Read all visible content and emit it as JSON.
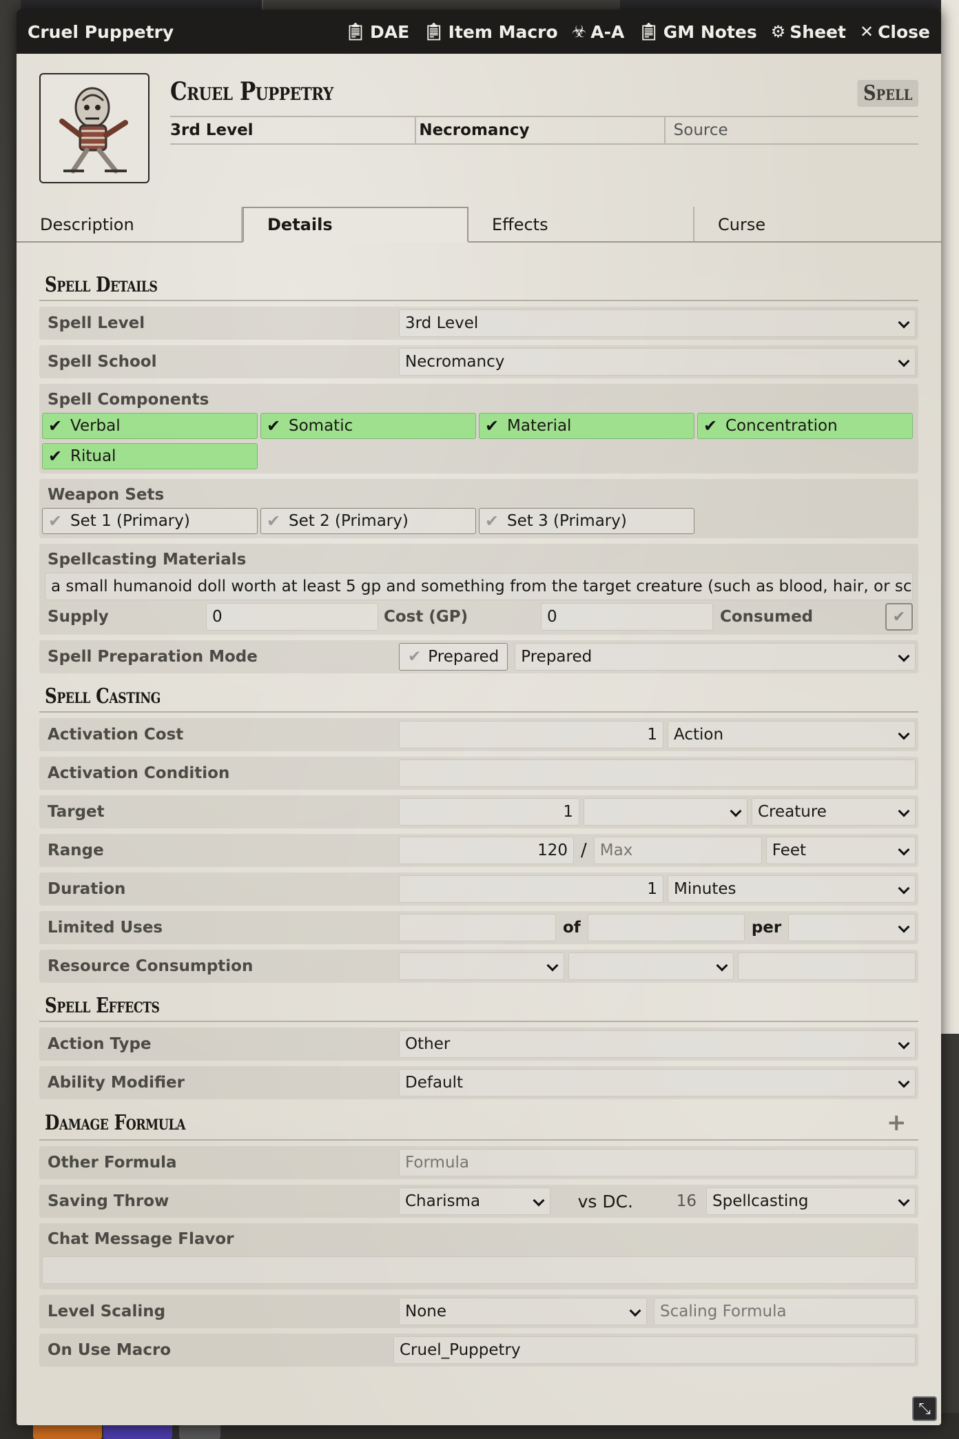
{
  "window": {
    "title": "Cruel Puppetry",
    "header_buttons": [
      {
        "label": "DAE",
        "icon": "clipboard-icon"
      },
      {
        "label": "Item Macro",
        "icon": "clipboard-icon"
      },
      {
        "label": "A-A",
        "icon": "biohazard-icon"
      },
      {
        "label": "GM Notes",
        "icon": "clipboard-icon"
      },
      {
        "label": "Sheet",
        "icon": "gear-icon"
      },
      {
        "label": "Close",
        "icon": "close-icon"
      }
    ]
  },
  "item": {
    "name": "Cruel Puppetry",
    "type": "Spell",
    "level": "3rd Level",
    "school": "Necromancy",
    "source_placeholder": "Source"
  },
  "tabs": [
    "Description",
    "Details",
    "Effects",
    "Curse"
  ],
  "active_tab": "Details",
  "spell_details": {
    "heading": "Spell Details",
    "level_label": "Spell Level",
    "level_value": "3rd Level",
    "school_label": "Spell School",
    "school_value": "Necromancy",
    "components_label": "Spell Components",
    "components": [
      {
        "label": "Verbal",
        "checked": true
      },
      {
        "label": "Somatic",
        "checked": true
      },
      {
        "label": "Material",
        "checked": true
      },
      {
        "label": "Concentration",
        "checked": true
      },
      {
        "label": "Ritual",
        "checked": true
      }
    ],
    "weapon_sets_label": "Weapon Sets",
    "weapon_sets": [
      {
        "label": "Set 1 (Primary)",
        "checked": false
      },
      {
        "label": "Set 2 (Primary)",
        "checked": false
      },
      {
        "label": "Set 3 (Primary)",
        "checked": false
      }
    ],
    "materials_label": "Spellcasting Materials",
    "materials_value": "a small humanoid doll worth at least 5 gp and something from the target creature (such as blood, hair, or scales)",
    "supply_label": "Supply",
    "supply_value": "0",
    "cost_label": "Cost (GP)",
    "cost_value": "0",
    "consumed_label": "Consumed",
    "prep_mode_label": "Spell Preparation Mode",
    "prep_toggle": "Prepared",
    "prep_select": "Prepared"
  },
  "spell_casting": {
    "heading": "Spell Casting",
    "activation_cost_label": "Activation Cost",
    "activation_cost_value": "1",
    "activation_type": "Action",
    "activation_condition_label": "Activation Condition",
    "activation_condition_value": "",
    "target_label": "Target",
    "target_value": "1",
    "target_units": "",
    "target_type": "Creature",
    "range_label": "Range",
    "range_value": "120",
    "range_sep": "/",
    "range_max_placeholder": "Max",
    "range_units": "Feet",
    "duration_label": "Duration",
    "duration_value": "1",
    "duration_units": "Minutes",
    "limited_uses_label": "Limited Uses",
    "uses_of": "of",
    "uses_per": "per",
    "resource_label": "Resource Consumption"
  },
  "spell_effects": {
    "heading": "Spell Effects",
    "action_type_label": "Action Type",
    "action_type_value": "Other",
    "ability_mod_label": "Ability Modifier",
    "ability_mod_value": "Default",
    "damage_heading": "Damage Formula",
    "add_symbol": "+",
    "other_formula_label": "Other Formula",
    "other_formula_placeholder": "Formula",
    "saving_throw_label": "Saving Throw",
    "saving_throw_ability": "Charisma",
    "vs_dc": "vs DC.",
    "dc_value": "16",
    "dc_scaling": "Spellcasting",
    "chat_flavor_label": "Chat Message Flavor",
    "level_scaling_label": "Level Scaling",
    "level_scaling_value": "None",
    "scaling_formula_placeholder": "Scaling Formula",
    "on_use_macro_label": "On Use Macro",
    "on_use_macro_value": "Cruel_Puppetry"
  },
  "colors": {
    "active_chip": "#9fe08f",
    "titlebar": "#1d1c1a",
    "parchment": "#dedad0"
  }
}
